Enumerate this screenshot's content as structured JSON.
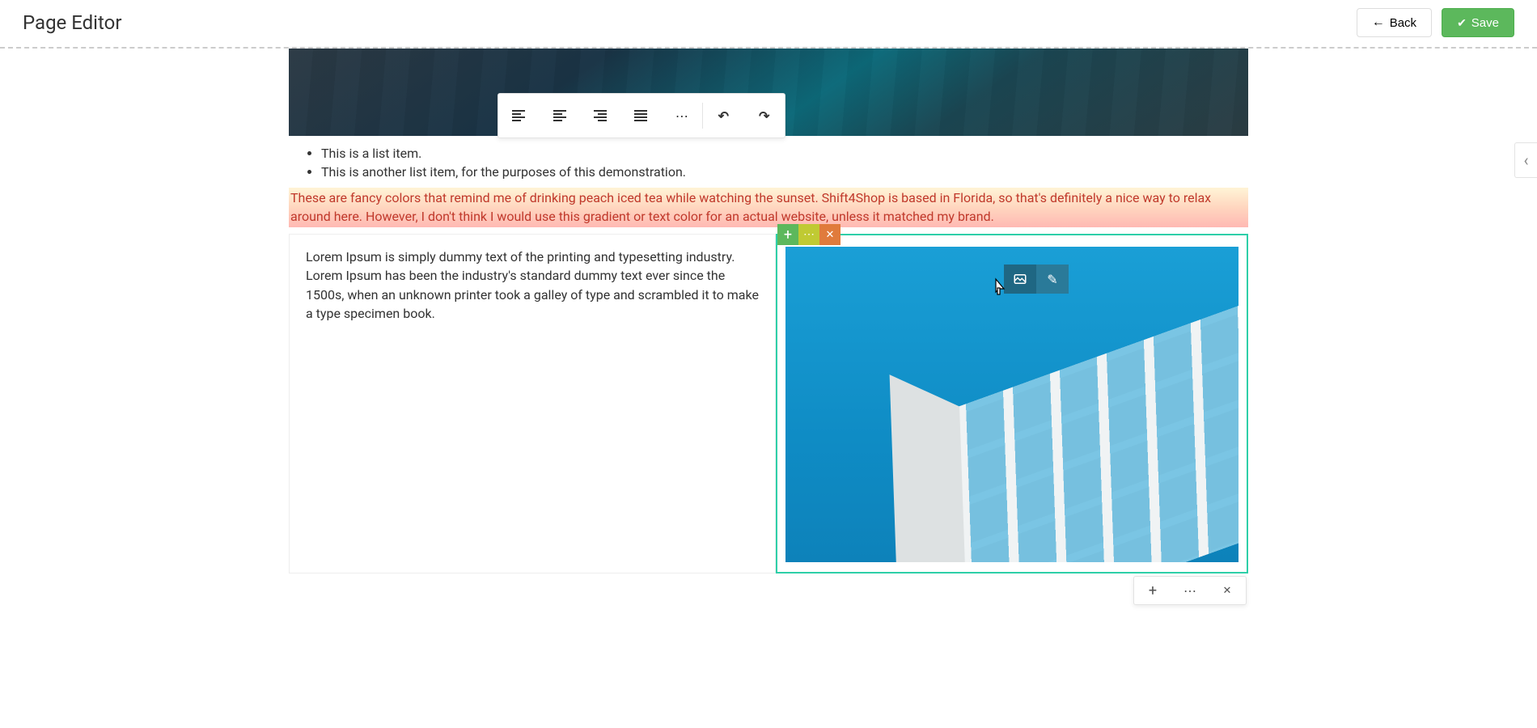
{
  "header": {
    "title": "Page Editor",
    "back_label": "Back",
    "save_label": "Save"
  },
  "toolbar": {
    "align_left": "Align Left",
    "align_center": "Align Center",
    "align_right": "Align Right",
    "align_justify": "Justify",
    "more": "More",
    "undo": "Undo",
    "redo": "Redo"
  },
  "content": {
    "list_items": [
      "This is a list item.",
      "This is another list item, for the purposes of this demonstration."
    ],
    "gradient_text": "These are fancy colors that remind me of drinking peach iced tea while watching the sunset. Shift4Shop is based in Florida, so that's definitely a nice way to relax around here. However, I don't think I would use this gradient or text color for an actual website, unless it matched my brand.",
    "lorem_text": "Lorem Ipsum is simply dummy text of the printing and typesetting industry. Lorem Ipsum has been the industry's standard dummy text ever since the 1500s, when an unknown printer took a galley of type and scrambled it to make a type specimen book."
  },
  "block_actions": {
    "add": "+",
    "more": "⋯",
    "close": "✕"
  },
  "image_toolbar": {
    "replace": "Replace Image",
    "edit": "Edit"
  },
  "bottom_toolbar": {
    "add": "Add",
    "more": "More",
    "close": "Close"
  },
  "side_panel": {
    "collapse": "Collapse panel"
  }
}
